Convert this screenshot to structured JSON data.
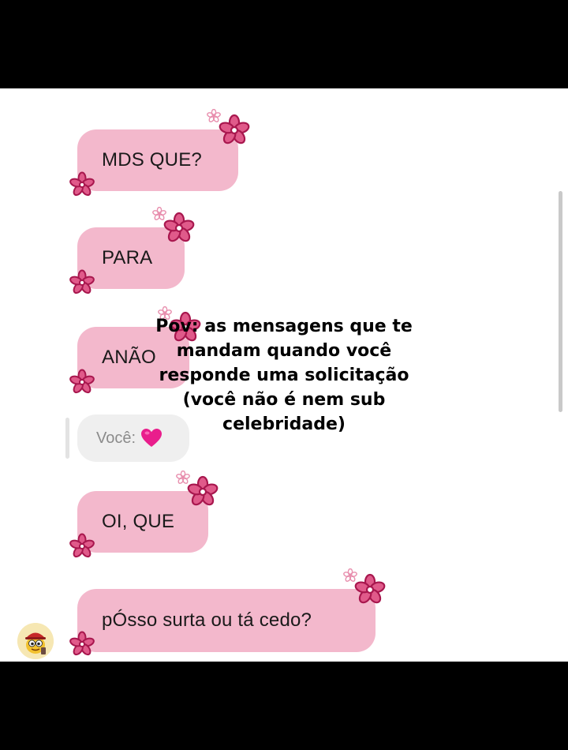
{
  "messages": [
    {
      "text": "MDS QUE?"
    },
    {
      "text": "PARA"
    },
    {
      "text": "ANÃO"
    },
    {
      "text": "OI, QUE"
    },
    {
      "text": "pÓsso surta ou tá cedo?"
    }
  ],
  "reply_quote": {
    "sender_label": "Você:",
    "icon": "pink-heart-icon"
  },
  "overlay_caption": "Pov: as mensagens que te mandam quando você responde uma solicitação (você não é nem sub celebridade)",
  "colors": {
    "bubble": "#f3b8cc",
    "flower": "#c2185b",
    "flower_light": "#e88fae",
    "heart": "#e91e8c",
    "quote_bg": "#efefef"
  },
  "avatar": {
    "icon": "cartoon-avatar-icon"
  }
}
